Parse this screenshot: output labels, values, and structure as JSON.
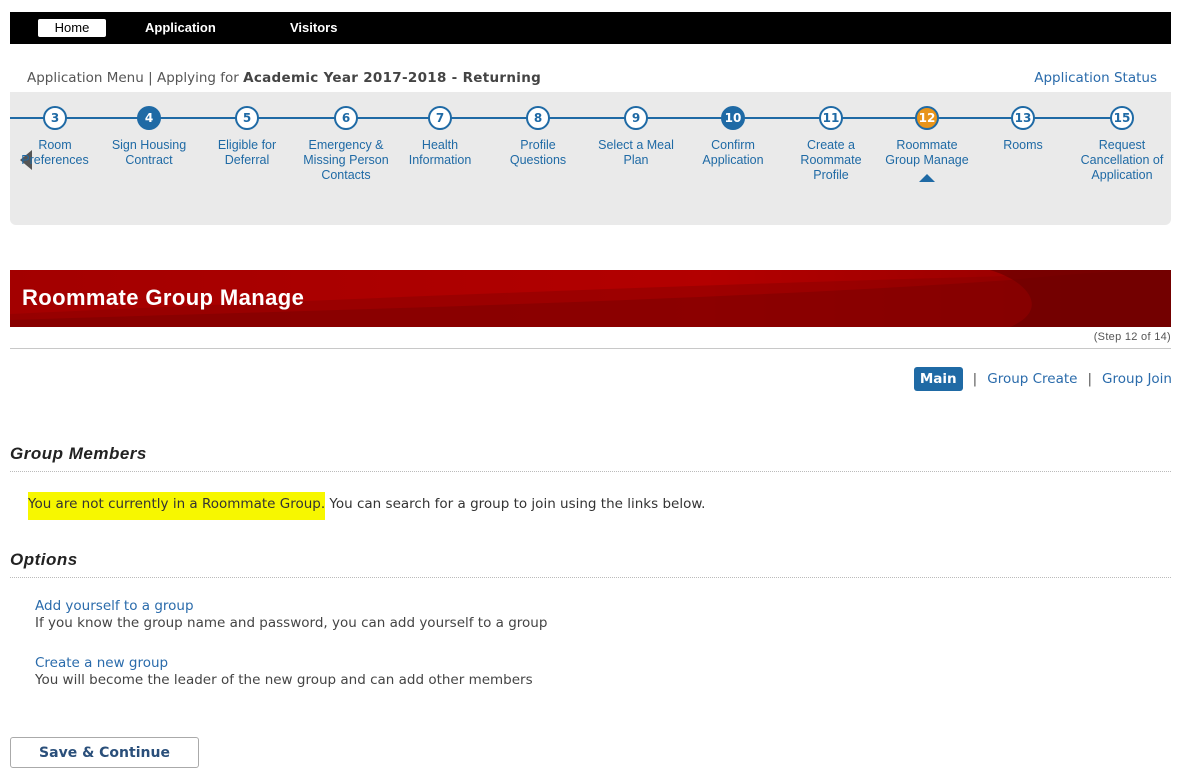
{
  "topnav": {
    "home": "Home",
    "application": "Application",
    "visitors": "Visitors"
  },
  "subheader": {
    "menu": "Application Menu",
    "sep": "|",
    "applying_for": "Applying for",
    "year": "Academic Year 2017-2018 - Returning",
    "status": "Application Status"
  },
  "steps": [
    {
      "num": "3",
      "label": "Room Preferences",
      "state": "pending"
    },
    {
      "num": "4",
      "label": "Sign Housing Contract",
      "state": "done"
    },
    {
      "num": "5",
      "label": "Eligible for Deferral",
      "state": "pending"
    },
    {
      "num": "6",
      "label": "Emergency & Missing Person Contacts",
      "state": "pending"
    },
    {
      "num": "7",
      "label": "Health Information",
      "state": "pending"
    },
    {
      "num": "8",
      "label": "Profile Questions",
      "state": "pending"
    },
    {
      "num": "9",
      "label": "Select a Meal Plan",
      "state": "pending"
    },
    {
      "num": "10",
      "label": "Confirm Application",
      "state": "done"
    },
    {
      "num": "11",
      "label": "Create a Roommate Profile",
      "state": "pending"
    },
    {
      "num": "12",
      "label": "Roommate Group Manage",
      "state": "current"
    },
    {
      "num": "13",
      "label": "Rooms",
      "state": "pending"
    },
    {
      "num": "15",
      "label": "Request Cancellation of Application",
      "state": "pending"
    }
  ],
  "banner": {
    "title": "Roommate Group Manage",
    "step_count": "(Step 12 of 14)"
  },
  "subtabs": {
    "main": "Main",
    "group_create": "Group Create",
    "group_join": "Group Join",
    "sep": "|"
  },
  "group_members": {
    "heading": "Group Members",
    "highlight": "You are not currently in a Roommate Group.",
    "rest": " You can search for a group to join using the links below."
  },
  "options": {
    "heading": "Options",
    "items": [
      {
        "link": "Add yourself to a group",
        "desc": "If you know the group name and password, you can add yourself to a group"
      },
      {
        "link": "Create a new group",
        "desc": "You will become the leader of the new group and can add other members"
      }
    ]
  },
  "save_label": "Save & Continue",
  "colors": {
    "accent_blue": "#1f6aa5",
    "current_orange": "#e8941a",
    "banner_red": "#a30000",
    "highlight_yellow": "#f7f700"
  }
}
